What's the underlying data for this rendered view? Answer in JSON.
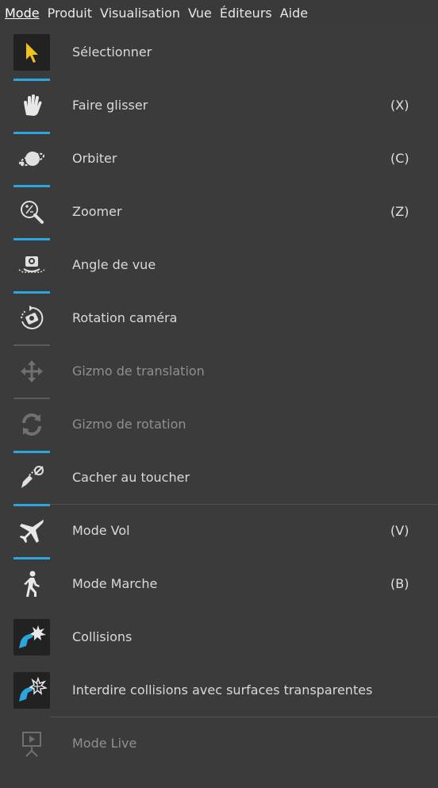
{
  "menubar": {
    "items": [
      "Mode",
      "Produit",
      "Visualisation",
      "Vue",
      "Éditeurs",
      "Aide"
    ]
  },
  "menu": {
    "items": [
      {
        "label": "Sélectionner",
        "shortcut": "",
        "icon": "cursor-arrow-icon"
      },
      {
        "label": "Faire glisser",
        "shortcut": "(X)",
        "icon": "hand-icon"
      },
      {
        "label": "Orbiter",
        "shortcut": "(C)",
        "icon": "orbit-icon"
      },
      {
        "label": "Zoomer",
        "shortcut": "(Z)",
        "icon": "zoom-icon"
      },
      {
        "label": "Angle de vue",
        "shortcut": "",
        "icon": "view-angle-icon"
      },
      {
        "label": "Rotation caméra",
        "shortcut": "",
        "icon": "camera-rotation-icon"
      },
      {
        "label": "Gizmo de translation",
        "shortcut": "",
        "icon": "translation-gizmo-icon"
      },
      {
        "label": "Gizmo de rotation",
        "shortcut": "",
        "icon": "rotation-gizmo-icon"
      },
      {
        "label": "Cacher au toucher",
        "shortcut": "",
        "icon": "hide-on-touch-icon"
      },
      {
        "label": "Mode Vol",
        "shortcut": "(V)",
        "icon": "airplane-icon"
      },
      {
        "label": "Mode Marche",
        "shortcut": "(B)",
        "icon": "walking-person-icon"
      },
      {
        "label": "Collisions",
        "shortcut": "",
        "icon": "collision-icon"
      },
      {
        "label": "Interdire collisions avec surfaces transparentes",
        "shortcut": "",
        "icon": "transparent-collision-icon"
      },
      {
        "label": "Mode Live",
        "shortcut": "",
        "icon": "live-mode-icon"
      }
    ]
  },
  "colors": {
    "accent": "#2aa6dc",
    "cursor": "#f2c21b",
    "background": "#3b3b3b"
  }
}
